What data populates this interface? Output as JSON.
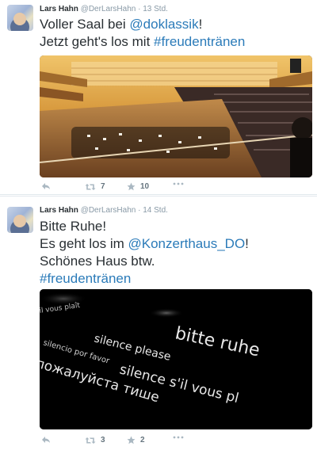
{
  "tweets": [
    {
      "author_name": "Lars Hahn",
      "author_handle": "@DerLarsHahn",
      "separator": "·",
      "time": "13 Std.",
      "text_lines": [
        [
          {
            "t": "Voller Saal bei ",
            "link": false
          },
          {
            "t": "@doklassik",
            "link": true
          },
          {
            "t": "!",
            "link": false
          }
        ],
        [
          {
            "t": "Jetzt geht's los mit ",
            "link": false
          },
          {
            "t": "#freudentränen",
            "link": true
          }
        ]
      ],
      "retweets": "7",
      "favorites": "10"
    },
    {
      "author_name": "Lars Hahn",
      "author_handle": "@DerLarsHahn",
      "separator": "·",
      "time": "14 Std.",
      "text_lines": [
        [
          {
            "t": "Bitte Ruhe!",
            "link": false
          }
        ],
        [
          {
            "t": "Es geht los im ",
            "link": false
          },
          {
            "t": "@Konzerthaus_DO",
            "link": true
          },
          {
            "t": "!",
            "link": false
          }
        ],
        [
          {
            "t": "Schönes Haus btw.",
            "link": false
          }
        ],
        [
          {
            "t": "#freudentränen",
            "link": true
          }
        ]
      ],
      "image_phrases": {
        "bitte_ruhe": "bitte ruhe",
        "silence_please": "silence please",
        "silencio": "silencio por favor",
        "sil_vous_plait": "silence s'il vous pl",
        "russian": "пожалуйста тише",
        "top_left": "il vous plaît"
      },
      "retweets": "3",
      "favorites": "2"
    }
  ],
  "colors": {
    "link": "#2b7bb9",
    "muted": "#8899a6",
    "text": "#292f33",
    "divider": "#e1e8ed"
  },
  "icons": [
    "reply-icon",
    "retweet-icon",
    "favorite-icon",
    "more-icon"
  ]
}
